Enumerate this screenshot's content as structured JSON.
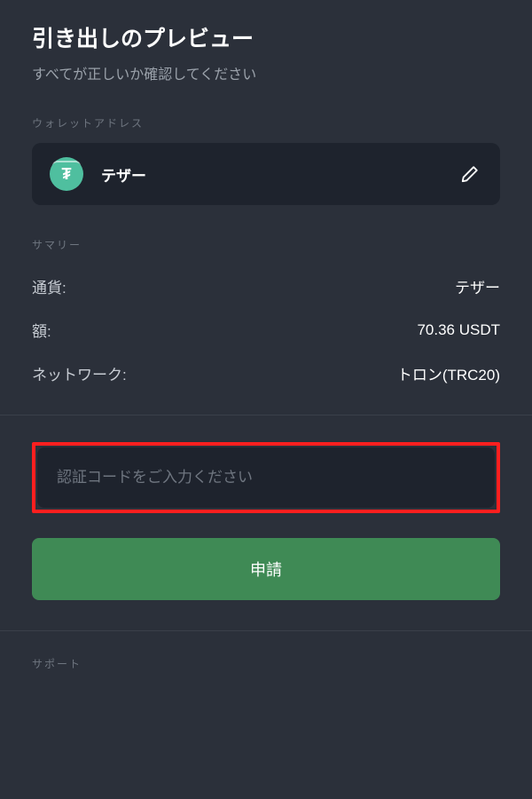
{
  "header": {
    "title": "引き出しのプレビュー",
    "subtitle": "すべてが正しいか確認してください"
  },
  "wallet": {
    "section_label": "ウォレットアドレス",
    "token_glyph": "₮",
    "name": "テザー"
  },
  "summary": {
    "section_label": "サマリー",
    "rows": [
      {
        "label": "通貨:",
        "value": "テザー"
      },
      {
        "label": "額:",
        "value": "70.36 USDT"
      },
      {
        "label": "ネットワーク:",
        "value": "トロン(TRC20)"
      }
    ]
  },
  "auth": {
    "placeholder": "認証コードをご入力ください"
  },
  "actions": {
    "submit_label": "申請"
  },
  "support": {
    "section_label": "サポート"
  }
}
